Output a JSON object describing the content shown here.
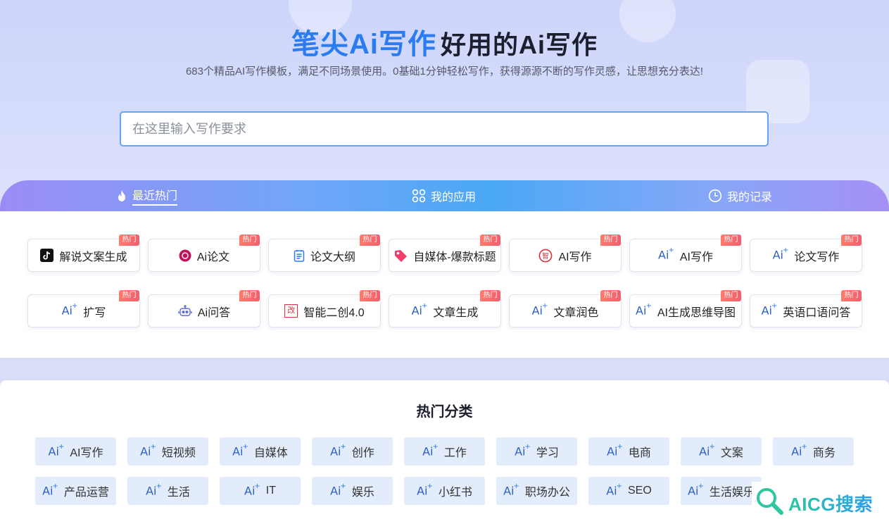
{
  "hero": {
    "brand": "笔尖Ai写作",
    "tagline": "好用的Ai写作",
    "subtitle": "683个精品AI写作模板，满足不同场景使用。0基础1分钟轻松写作，获得源源不断的写作灵感，让思想充分表达!",
    "search_placeholder": "在这里输入写作要求"
  },
  "tabs": [
    {
      "label": "最近热门",
      "icon": "flame-icon",
      "active": true
    },
    {
      "label": "我的应用",
      "icon": "grid-icon",
      "active": false
    },
    {
      "label": "我的记录",
      "icon": "clock-icon",
      "active": false
    }
  ],
  "hot_badge": "热门",
  "apps": [
    {
      "label": "解说文案生成",
      "icon": "tiktok-icon"
    },
    {
      "label": "Ai论文",
      "icon": "paper-icon"
    },
    {
      "label": "论文大纲",
      "icon": "outline-icon"
    },
    {
      "label": "自媒体-爆款标题",
      "icon": "tag-icon"
    },
    {
      "label": "AI写作",
      "icon": "write-seal-icon"
    },
    {
      "label": "AI写作",
      "icon": "ai-icon"
    },
    {
      "label": "论文写作",
      "icon": "ai-icon"
    },
    {
      "label": "扩写",
      "icon": "ai-icon"
    },
    {
      "label": "Ai问答",
      "icon": "robot-icon"
    },
    {
      "label": "智能二创4.0",
      "icon": "edit-icon"
    },
    {
      "label": "文章生成",
      "icon": "ai-icon"
    },
    {
      "label": "文章润色",
      "icon": "ai-icon"
    },
    {
      "label": "AI生成思维导图",
      "icon": "ai-icon"
    },
    {
      "label": "英语口语问答",
      "icon": "ai-icon"
    }
  ],
  "edit_icon_char": "改",
  "categories": {
    "title": "热门分类",
    "ai_mark": "Ai",
    "items": [
      "AI写作",
      "短视频",
      "自媒体",
      "创作",
      "工作",
      "学习",
      "电商",
      "文案",
      "商务",
      "产品运营",
      "生活",
      "IT",
      "娱乐",
      "小红书",
      "职场办公",
      "SEO",
      "生活娱乐"
    ]
  },
  "watermark": {
    "text": "AICG搜索",
    "icon": "magnifier-icon"
  },
  "colors": {
    "brand": "#2a7cf0",
    "hot": "#f0606e",
    "chip_bg": "#e3ecfa"
  }
}
